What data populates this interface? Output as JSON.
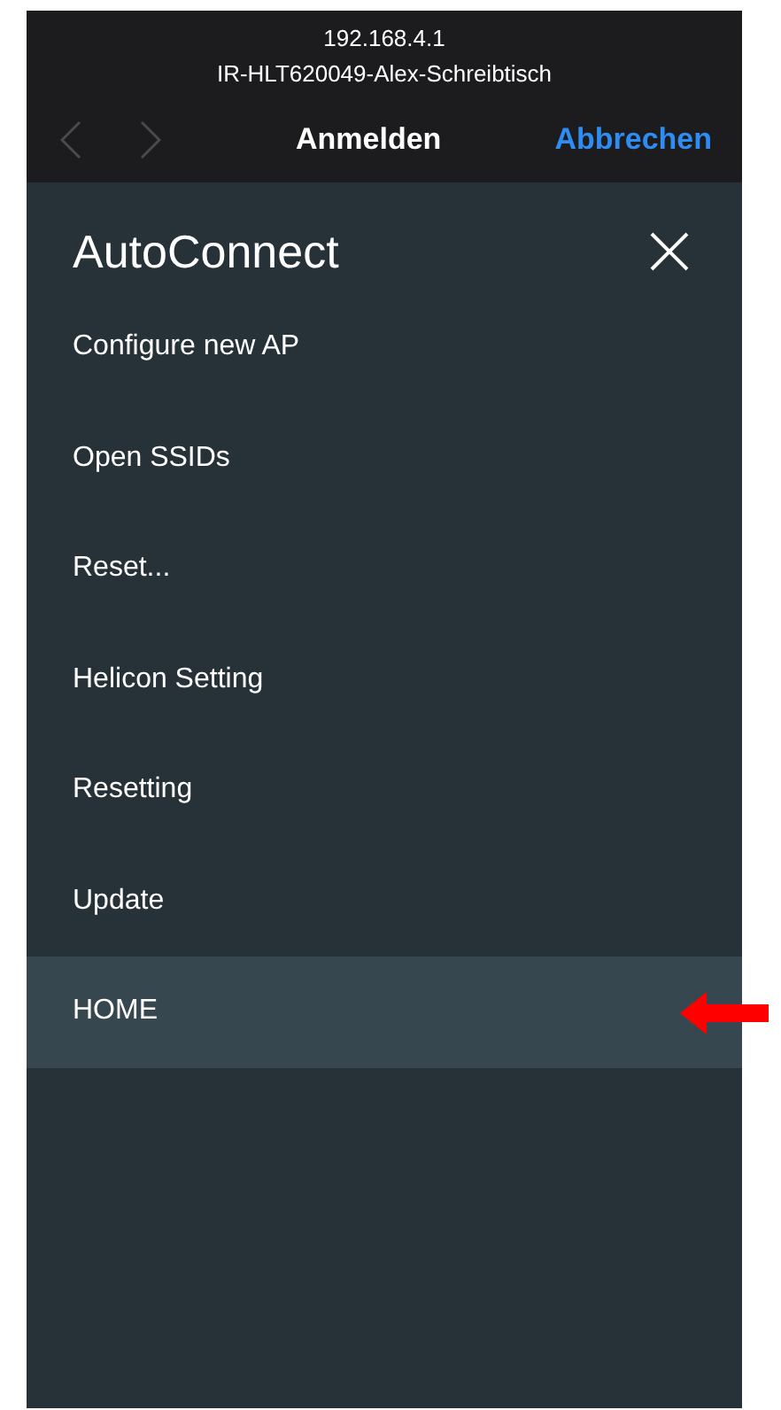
{
  "browser_bar": {
    "address": "192.168.4.1",
    "network": "IR-HLT620049-Alex-Schreibtisch",
    "title": "Anmelden",
    "cancel": "Abbrechen"
  },
  "menu": {
    "title": "AutoConnect",
    "items": [
      {
        "label": "Configure new AP",
        "selected": false
      },
      {
        "label": "Open SSIDs",
        "selected": false
      },
      {
        "label": "Reset...",
        "selected": false
      },
      {
        "label": "Helicon Setting",
        "selected": false
      },
      {
        "label": "Resetting",
        "selected": false
      },
      {
        "label": "Update",
        "selected": false
      },
      {
        "label": "HOME",
        "selected": true
      }
    ]
  }
}
